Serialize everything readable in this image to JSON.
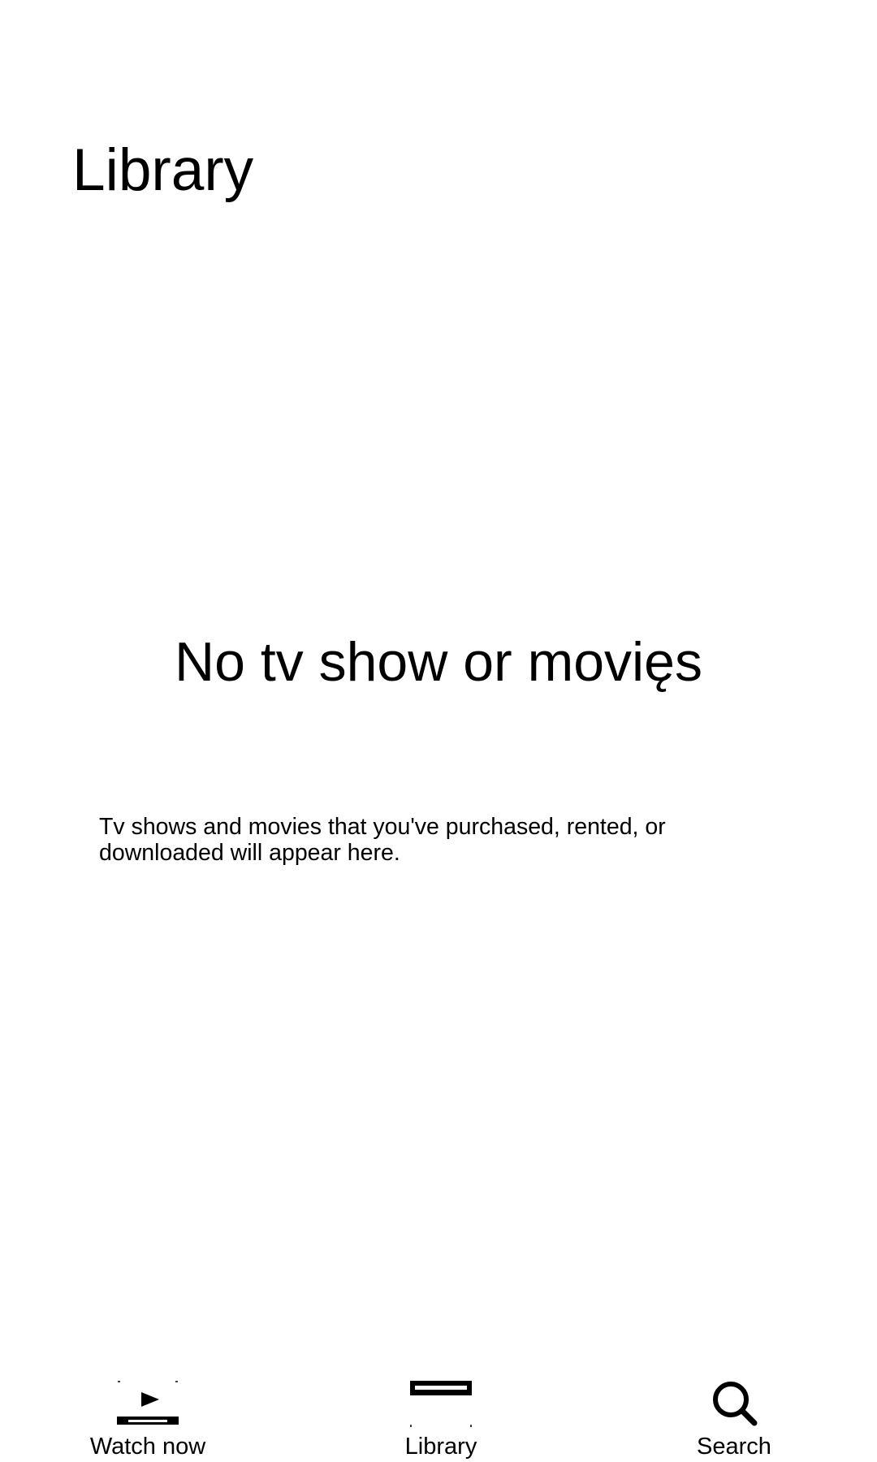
{
  "header": {
    "title": "Library"
  },
  "empty_state": {
    "title": "No tv show or movięs",
    "description": "Tv shows and movies that you've purchased, rented, or downloaded will appear here."
  },
  "tab_bar": {
    "tabs": [
      {
        "label": "Watch now",
        "icon": "play-icon"
      },
      {
        "label": "Library",
        "icon": "library-icon"
      },
      {
        "label": "Search",
        "icon": "search-icon"
      }
    ]
  },
  "colors": {
    "background": "#ffffff",
    "text": "#000000"
  }
}
